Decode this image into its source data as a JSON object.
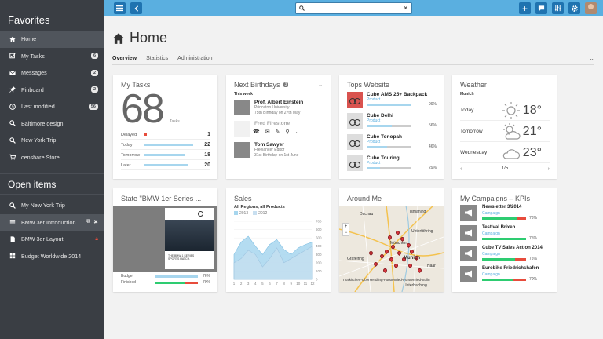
{
  "sidebar": {
    "favorites_title": "Favorites",
    "favorites": [
      {
        "label": "Home",
        "icon": "home-icon",
        "badge": ""
      },
      {
        "label": "My Tasks",
        "icon": "checkbox-icon",
        "badge": "6"
      },
      {
        "label": "Messages",
        "icon": "envelope-icon",
        "badge": "2"
      },
      {
        "label": "Pinboard",
        "icon": "pin-icon",
        "badge": "2"
      },
      {
        "label": "Last modified",
        "icon": "clock-icon",
        "badge": "56"
      },
      {
        "label": "Baltimore design",
        "icon": "search-icon",
        "badge": ""
      },
      {
        "label": "New York Trip",
        "icon": "search-icon",
        "badge": ""
      },
      {
        "label": "censhare Store",
        "icon": "cart-icon",
        "badge": ""
      }
    ],
    "open_title": "Open items",
    "open_items": [
      {
        "label": "My New York Trip"
      },
      {
        "label": "BMW 3er Introduction"
      },
      {
        "label": "BMW 3er Layout"
      },
      {
        "label": "Budget Worldwide 2014"
      }
    ]
  },
  "topbar": {
    "search_value": ""
  },
  "page": {
    "title": "Home",
    "tabs": [
      "Overview",
      "Statistics",
      "Administration"
    ]
  },
  "my_tasks": {
    "title": "My Tasks",
    "total": "68",
    "total_label": "Tasks",
    "rows": [
      {
        "label": "Delayed",
        "value": "1",
        "fill": 0.03
      },
      {
        "label": "Today",
        "value": "22",
        "fill": 0.7
      },
      {
        "label": "Tomorrow",
        "value": "18",
        "fill": 0.6
      },
      {
        "label": "Later",
        "value": "20",
        "fill": 0.65
      }
    ]
  },
  "birthdays": {
    "title": "Next Birthdays",
    "count": "3",
    "week_label": "This week",
    "people": [
      {
        "name": "Prof. Albert Einstein",
        "line1": "Princeton University",
        "line2": "75th Birthday on 27th May"
      },
      {
        "name": "Fred Firestone",
        "line1": "",
        "line2": ""
      },
      {
        "name": "Tom Sawyer",
        "line1": "Freelancer Editor",
        "line2": "31st Birthday on 1st June"
      }
    ]
  },
  "top_websites": {
    "title": "Tops Website",
    "items": [
      {
        "name": "Cube AMS 25+ Backpack",
        "type": "Product",
        "pct": "99%",
        "fill": 0.99
      },
      {
        "name": "Cube Delhi",
        "type": "Product",
        "pct": "56%",
        "fill": 0.56
      },
      {
        "name": "Cube Tonopah",
        "type": "Product",
        "pct": "46%",
        "fill": 0.46
      },
      {
        "name": "Cube Touring",
        "type": "Product",
        "pct": "29%",
        "fill": 0.29
      }
    ]
  },
  "weather": {
    "title": "Weather",
    "city": "Munich",
    "days": [
      {
        "day": "Today",
        "temp": "18°",
        "icon": "sun-icon"
      },
      {
        "day": "Tomorrow",
        "temp": "21°",
        "icon": "partly-cloudy-icon"
      },
      {
        "day": "Wednesday",
        "temp": "23°",
        "icon": "cloud-icon"
      }
    ],
    "page": "1/5"
  },
  "state_card": {
    "title": "State \"BMW 1er Series ...",
    "brochure_text": "THE BMW 1 SERIES SPORTS HATCH.",
    "rows": [
      {
        "label": "Budget",
        "pct": "76%",
        "fill": 0.76,
        "color": "#a7d6ee"
      },
      {
        "label": "Finished",
        "pct": "70%",
        "fill": 0.7,
        "color": "#2ecc71"
      }
    ]
  },
  "sales": {
    "title": "Sales",
    "subtitle": "All Regions, all Products",
    "legend": [
      "2013",
      "2012"
    ]
  },
  "chart_data": {
    "type": "area",
    "x": [
      "1",
      "2",
      "3",
      "4",
      "5",
      "6",
      "7",
      "8",
      "9",
      "10",
      "11",
      "12"
    ],
    "ylim": [
      0,
      700
    ],
    "yticks": [
      "0",
      "100",
      "200",
      "300",
      "400",
      "500",
      "600",
      "700"
    ],
    "series": [
      {
        "name": "2013",
        "values": [
          300,
          450,
          520,
          400,
          300,
          420,
          480,
          360,
          300,
          380,
          420,
          450
        ]
      },
      {
        "name": "2012",
        "values": [
          200,
          250,
          350,
          300,
          150,
          250,
          380,
          200,
          250,
          300,
          350,
          400
        ]
      }
    ],
    "colors": [
      "#a7d6ee",
      "#c8dff0"
    ]
  },
  "around_me": {
    "title": "Around Me",
    "places": [
      "Dachau",
      "Ismaning",
      "Unterföhring",
      "München",
      "Munich",
      "Haar",
      "Thalkirchen-Obersendling-Forstenried-Fürstenried-Solln",
      "Unterhaching",
      "Gräfelfing"
    ]
  },
  "campaigns": {
    "title": "My Campaigns – KPIs",
    "items": [
      {
        "name": "Newsletter 3/2014",
        "type": "Campaign",
        "pct": "76%",
        "red": 0.2
      },
      {
        "name": "Testival Brixen",
        "type": "Campaign",
        "pct": "75%",
        "red": 0.0
      },
      {
        "name": "Cube TV Sales Action 2014",
        "type": "Campaign",
        "pct": "75%",
        "red": 0.25
      },
      {
        "name": "Eurobike Friedrichshafen",
        "type": "Campaign",
        "pct": "70%",
        "red": 0.3
      }
    ]
  }
}
